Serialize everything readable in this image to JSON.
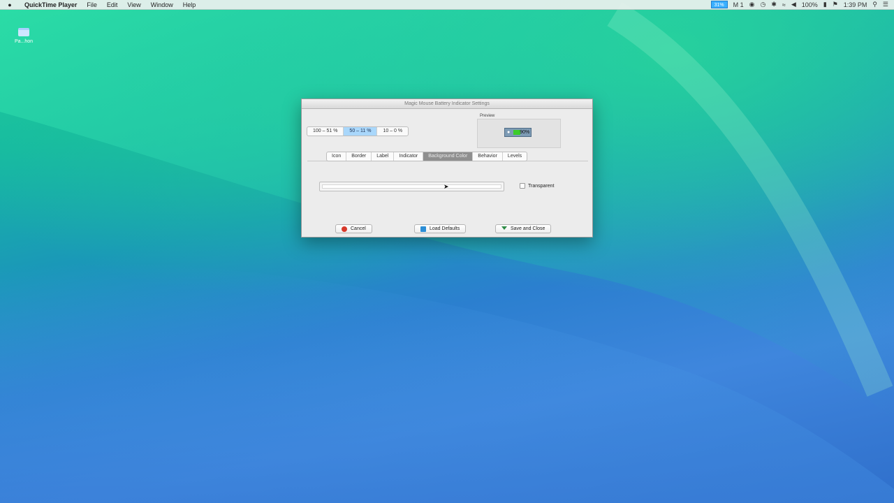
{
  "menubar": {
    "app_name": "QuickTime Player",
    "items": [
      "File",
      "Edit",
      "View",
      "Window",
      "Help"
    ],
    "battery_text": "31%",
    "mic_text": "M 1",
    "battery_pct": "100%",
    "time": "1:39 PM"
  },
  "desktop": {
    "icon_label": "Pa...hon"
  },
  "dialog": {
    "title": "Magic Mouse Battery Indicator Settings",
    "level_segments": [
      "100 – 51 %",
      "50 – 11 %",
      "10 – 0 %"
    ],
    "preview_label": "Preview",
    "preview_text": "90%",
    "tabs": [
      "Icon",
      "Border",
      "Label",
      "Indicator",
      "Background Color",
      "Behavior",
      "Levels"
    ],
    "transparent_label": "Transparent",
    "buttons": {
      "cancel": "Cancel",
      "load_defaults": "Load Defaults",
      "save_close": "Save and Close"
    }
  },
  "colors": {
    "selected_segment": "#a9d7fb",
    "selected_tab": "#8f8f8f",
    "battery_fill": "#3ccc2a"
  }
}
